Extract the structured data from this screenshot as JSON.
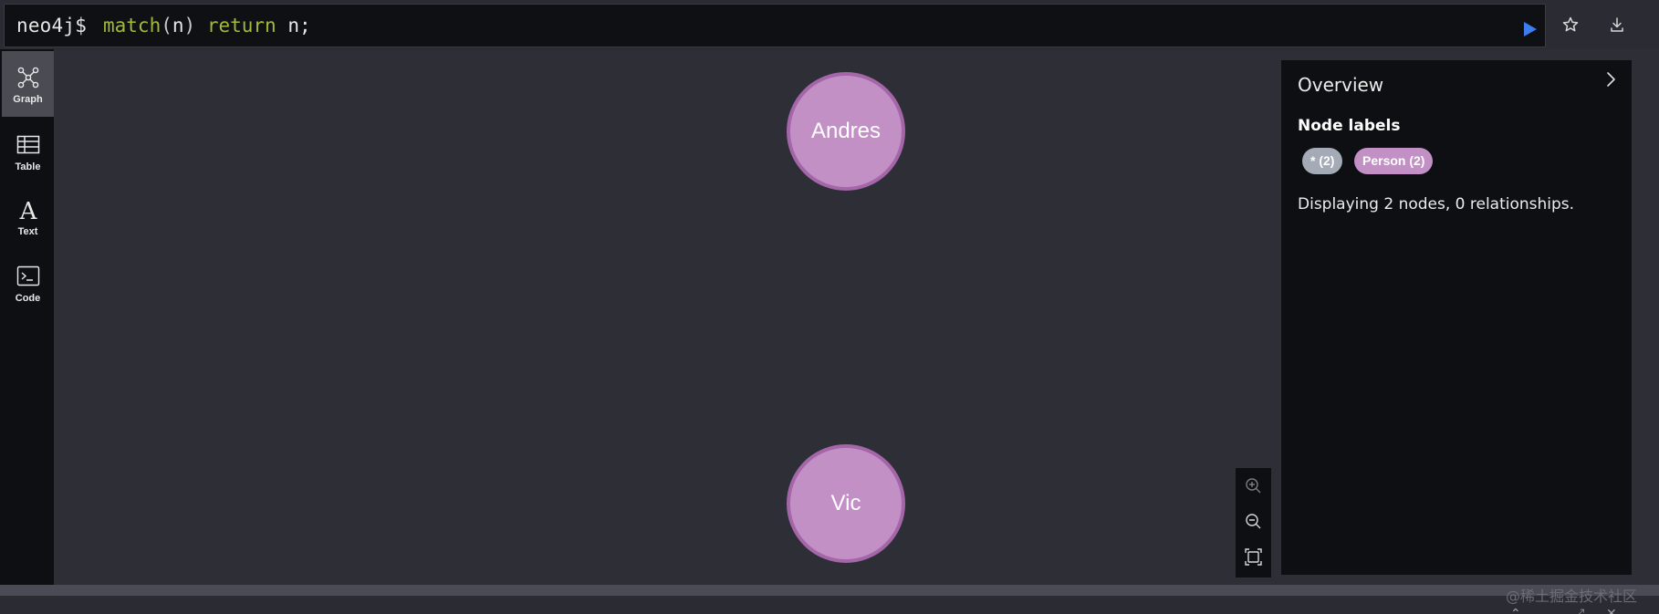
{
  "editor": {
    "prompt": "neo4j$",
    "query_keyword": "match",
    "query_open": "(",
    "query_var": "n",
    "query_close": ")",
    "query_return": "return",
    "query_result": "n;"
  },
  "toolbar": {
    "run_icon": "play-icon",
    "favorite_icon": "star-icon",
    "download_icon": "download-icon"
  },
  "sidebar": {
    "items": [
      {
        "label": "Graph",
        "icon": "graph-icon",
        "active": true
      },
      {
        "label": "Table",
        "icon": "table-icon",
        "active": false
      },
      {
        "label": "Text",
        "icon": "text-icon",
        "active": false
      },
      {
        "label": "Code",
        "icon": "code-icon",
        "active": false
      }
    ]
  },
  "graph": {
    "nodes": [
      {
        "label": "Andres",
        "type": "Person"
      },
      {
        "label": "Vic",
        "type": "Person"
      }
    ],
    "node_color": "#c390c6",
    "node_border": "#a465a9"
  },
  "zoom": {
    "zoom_in_icon": "zoom-in-icon",
    "zoom_out_icon": "zoom-out-icon",
    "fit_icon": "fit-icon"
  },
  "overview": {
    "title": "Overview",
    "section": "Node labels",
    "chips": [
      {
        "label": "* (2)",
        "color": "#a5abb6"
      },
      {
        "label": "Person (2)",
        "color": "#c390c6"
      }
    ],
    "status": "Displaying 2 nodes, 0 relationships."
  },
  "watermark": "@稀土掘金技术社区",
  "colors": {
    "canvas_bg": "#2d2e36",
    "panel_bg": "#0e0f12",
    "run_accent": "#3d7df0",
    "keyword": "#a3b83b"
  }
}
